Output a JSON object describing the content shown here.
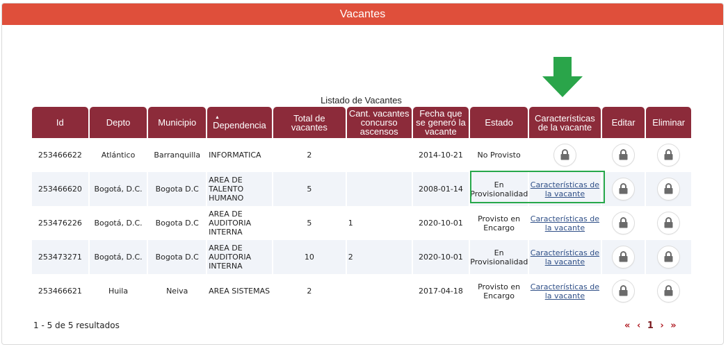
{
  "header": {
    "title": "Vacantes"
  },
  "table": {
    "caption": "Listado de Vacantes",
    "columns": {
      "id": "Id",
      "depto": "Depto",
      "municipio": "Municipio",
      "dependencia": "Dependencia",
      "total": "Total de vacantes",
      "cant": "Cant. vacantes concurso ascensos",
      "fecha": "Fecha que se generó la vacante",
      "estado": "Estado",
      "caract": "Características de la vacante",
      "editar": "Editar",
      "eliminar": "Eliminar"
    },
    "sort_indicator": "▲",
    "rows": [
      {
        "id": "253466622",
        "depto": "Atlántico",
        "municipio": "Barranquilla",
        "dependencia": "INFORMATICA",
        "total": "2",
        "cant": "",
        "fecha": "2014-10-21",
        "estado": "No Provisto",
        "caract": ""
      },
      {
        "id": "253466620",
        "depto": "Bogotá, D.C.",
        "municipio": "Bogota D.C",
        "dependencia": "AREA DE TALENTO HUMANO",
        "total": "5",
        "cant": "",
        "fecha": "2008-01-14",
        "estado": "En Provisionalidad",
        "caract": "Características de la vacante"
      },
      {
        "id": "253476226",
        "depto": "Bogotá, D.C.",
        "municipio": "Bogota D.C",
        "dependencia": "AREA DE AUDITORIA INTERNA",
        "total": "5",
        "cant": "1",
        "fecha": "2020-10-01",
        "estado": "Provisto en Encargo",
        "caract": "Características de la vacante"
      },
      {
        "id": "253473271",
        "depto": "Bogotá, D.C.",
        "municipio": "Bogota D.C",
        "dependencia": "AREA DE AUDITORIA INTERNA",
        "total": "10",
        "cant": "2",
        "fecha": "2020-10-01",
        "estado": "En Provisionalidad",
        "caract": "Características de la vacante"
      },
      {
        "id": "253466621",
        "depto": "Huila",
        "municipio": "Neiva",
        "dependencia": "AREA SISTEMAS",
        "total": "2",
        "cant": "",
        "fecha": "2017-04-18",
        "estado": "Provisto en Encargo",
        "caract": "Características de la vacante"
      }
    ]
  },
  "footer": {
    "results": "1 - 5 de 5 resultados",
    "pager": {
      "first": "«",
      "prev": "‹",
      "current": "1",
      "next": "›",
      "last": "»"
    }
  },
  "colors": {
    "header_bg": "#df4f3b",
    "column_header_bg": "#8c2b3a",
    "highlight": "#27a84a",
    "arrow": "#2aa54a",
    "link": "#2f4f87",
    "pager": "#b11e26"
  },
  "icons": {
    "arrow": "arrow-down-icon",
    "lock": "lock-icon"
  }
}
